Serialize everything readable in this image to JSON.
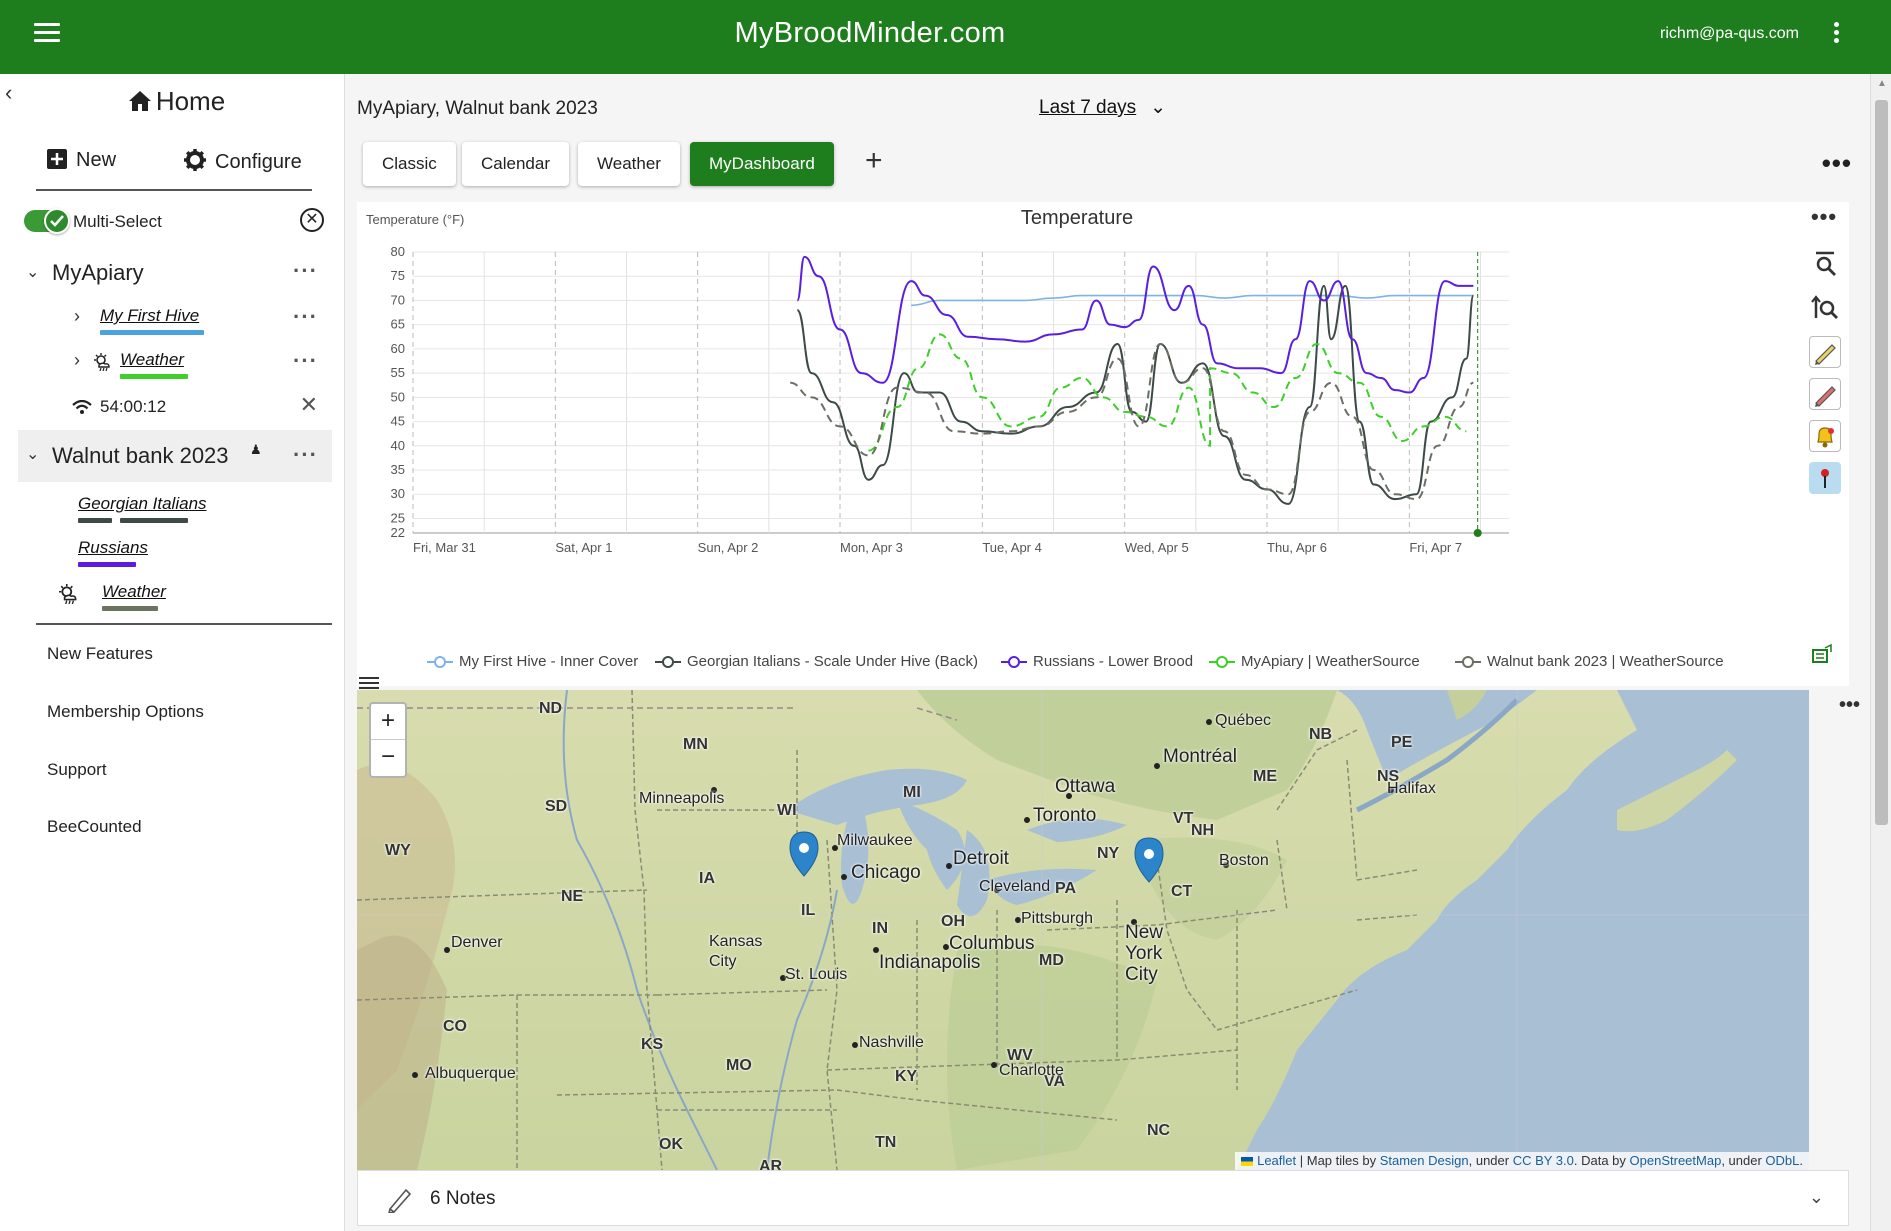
{
  "topbar": {
    "title": "MyBroodMinder.com",
    "user_email": "richm@pa-qus.com"
  },
  "sidebar": {
    "home_label": "Home",
    "new_label": "New",
    "configure_label": "Configure",
    "multiselect_label": "Multi-Select",
    "groups": [
      {
        "name": "MyApiary",
        "items": [
          {
            "label": "My First Hive",
            "color": "#4aa3df"
          },
          {
            "label": "Weather",
            "color": "#3ecf2a"
          }
        ],
        "device": {
          "label": "54:00:12"
        }
      },
      {
        "name": "Walnut bank 2023",
        "items": [
          {
            "label": "Georgian Italians",
            "color": "#3d4a48"
          },
          {
            "label": "Russians",
            "color": "#5a1ee0"
          },
          {
            "label": "Weather",
            "color": "#6b7460"
          }
        ]
      }
    ],
    "links": [
      "New Features",
      "Membership Options",
      "Support",
      "BeeCounted"
    ]
  },
  "main": {
    "breadcrumb": "MyApiary,  Walnut bank 2023",
    "date_range": "Last 7 days",
    "tabs": [
      "Classic",
      "Calendar",
      "Weather",
      "MyDashboard"
    ],
    "active_tab": "MyDashboard",
    "notes_label": "6 Notes"
  },
  "map": {
    "zoom_in": "+",
    "zoom_out": "−",
    "labels": {
      "states": [
        "ND",
        "MN",
        "SD",
        "WY",
        "WI",
        "MI",
        "IA",
        "NE",
        "IL",
        "IN",
        "OH",
        "CO",
        "KS",
        "MO",
        "KY",
        "WV",
        "VA",
        "TN",
        "NC",
        "OK",
        "AR",
        "PA",
        "NY",
        "VT",
        "NH",
        "CT",
        "ME",
        "NB",
        "PE",
        "NS",
        "MD"
      ],
      "cities": [
        "Minneapolis",
        "Milwaukee",
        "Chicago",
        "Detroit",
        "Cleveland",
        "Toronto",
        "Ottawa",
        "Montréal",
        "Québec",
        "Boston",
        "Halifax",
        "Pittsburgh",
        "Columbus",
        "Indianapolis",
        "Kansas City",
        "St. Louis",
        "Denver",
        "Nashville",
        "Charlotte",
        "Albuquerque",
        "New York City"
      ]
    },
    "attribution": {
      "leaflet": "Leaflet",
      "text1": " | Map tiles by ",
      "stamen": "Stamen Design",
      "text2": ", under ",
      "ccby": "CC BY 3.0",
      "text3": ". Data by ",
      "osm": "OpenStreetMap",
      "text4": ", under ",
      "odbl": "ODbL",
      "text5": "."
    }
  },
  "chart_data": {
    "type": "line",
    "title": "Temperature",
    "ylabel": "Temperature (°F)",
    "ylim": [
      22,
      80
    ],
    "yticks": [
      80,
      75,
      70,
      65,
      60,
      55,
      50,
      45,
      40,
      35,
      30,
      25,
      22
    ],
    "xticks": [
      "Fri, Mar 31",
      "Sat, Apr 1",
      "Sun, Apr 2",
      "Mon, Apr 3",
      "Tue, Apr 4",
      "Wed, Apr 5",
      "Thu, Apr 6",
      "Fri, Apr 7"
    ],
    "x_range_days": [
      0,
      7.7
    ],
    "grid": true,
    "legend_position": "bottom",
    "series": [
      {
        "name": "My First Hive - Inner Cover",
        "color": "#7fb3e6",
        "dash": "solid",
        "x": [
          3.5,
          3.7,
          3.9,
          4.1,
          4.3,
          4.5,
          4.7,
          4.9,
          5.1,
          5.3,
          5.5,
          5.7,
          5.9,
          6.1,
          6.3,
          6.5,
          6.7,
          6.9,
          7.1,
          7.3,
          7.45
        ],
        "y": [
          69,
          70,
          70,
          70,
          70,
          70.5,
          71,
          71,
          71,
          71,
          71,
          70.5,
          71,
          71,
          71,
          71,
          70.5,
          71,
          71,
          71,
          71
        ]
      },
      {
        "name": "Georgian Italians  - Scale Under Hive (Back)",
        "color": "#3d4a48",
        "dash": "solid",
        "x": [
          2.7,
          2.8,
          2.95,
          3.1,
          3.2,
          3.3,
          3.45,
          3.55,
          3.7,
          3.85,
          4.0,
          4.2,
          4.4,
          4.6,
          4.8,
          4.95,
          5.05,
          5.15,
          5.25,
          5.4,
          5.55,
          5.7,
          5.85,
          6.0,
          6.15,
          6.3,
          6.4,
          6.45,
          6.55,
          6.65,
          6.75,
          6.9,
          7.05,
          7.15,
          7.3,
          7.4,
          7.45
        ],
        "y": [
          68,
          55,
          49,
          40,
          33,
          36,
          55,
          51,
          51,
          45,
          43,
          42.5,
          44,
          48,
          51,
          61,
          47,
          45,
          61,
          53,
          57,
          42,
          33,
          31,
          28,
          48,
          73,
          62,
          73,
          45,
          32,
          29,
          30,
          45,
          50,
          58,
          71
        ]
      },
      {
        "name": "Russians - Lower Brood",
        "color": "#5a1ee0",
        "dash": "solid",
        "x": [
          2.7,
          2.75,
          2.85,
          3.0,
          3.15,
          3.3,
          3.5,
          3.6,
          3.75,
          3.9,
          4.1,
          4.3,
          4.5,
          4.7,
          4.8,
          4.9,
          5.0,
          5.1,
          5.2,
          5.35,
          5.45,
          5.55,
          5.65,
          5.8,
          5.95,
          6.1,
          6.2,
          6.3,
          6.4,
          6.5,
          6.6,
          6.7,
          6.8,
          6.9,
          7.0,
          7.1,
          7.25,
          7.35,
          7.45
        ],
        "y": [
          70,
          79,
          75,
          64,
          55,
          53,
          74,
          71,
          67,
          62.5,
          62,
          61.5,
          63,
          64,
          70,
          65,
          64.5,
          66,
          77,
          68,
          73,
          65,
          57,
          56,
          56,
          55,
          62,
          74,
          70,
          74,
          62,
          55,
          54,
          51.5,
          51,
          54,
          74,
          73,
          73
        ]
      },
      {
        "name": "MyApiary | WeatherSource",
        "color": "#3ecf2a",
        "dash": "dashed",
        "x": [
          5.6,
          3.2,
          3.4,
          3.55,
          3.7,
          3.85,
          4.0,
          4.2,
          4.4,
          4.55,
          4.7,
          4.85,
          5.0,
          5.15,
          5.3,
          5.45,
          5.6,
          5.75,
          5.9,
          6.05,
          6.2,
          6.35,
          6.5,
          6.65,
          6.8,
          6.95,
          7.1,
          7.25,
          7.4
        ],
        "y": [
          40,
          39,
          48,
          56,
          63,
          58,
          50,
          44,
          46,
          52,
          54,
          50,
          47,
          46,
          44,
          52,
          56,
          55,
          51,
          48,
          54,
          61,
          55,
          53,
          46,
          41,
          44,
          46,
          43
        ]
      },
      {
        "name": "Walnut bank 2023 | WeatherSource",
        "color": "#6b6f63",
        "dash": "dashed",
        "x": [
          2.65,
          2.8,
          3.0,
          3.2,
          3.4,
          3.6,
          3.8,
          4.0,
          4.2,
          4.4,
          4.6,
          4.8,
          4.95,
          5.1,
          5.25,
          5.4,
          5.55,
          5.7,
          5.85,
          6.0,
          6.15,
          6.3,
          6.45,
          6.6,
          6.75,
          6.9,
          7.05,
          7.2,
          7.35,
          7.45
        ],
        "y": [
          53,
          50,
          44,
          38,
          52,
          51,
          43,
          42.5,
          43,
          44,
          47,
          50,
          58,
          44,
          61,
          53,
          56,
          43,
          34,
          31,
          30,
          47,
          53,
          46,
          35,
          30,
          29,
          40,
          48,
          53
        ]
      }
    ]
  }
}
